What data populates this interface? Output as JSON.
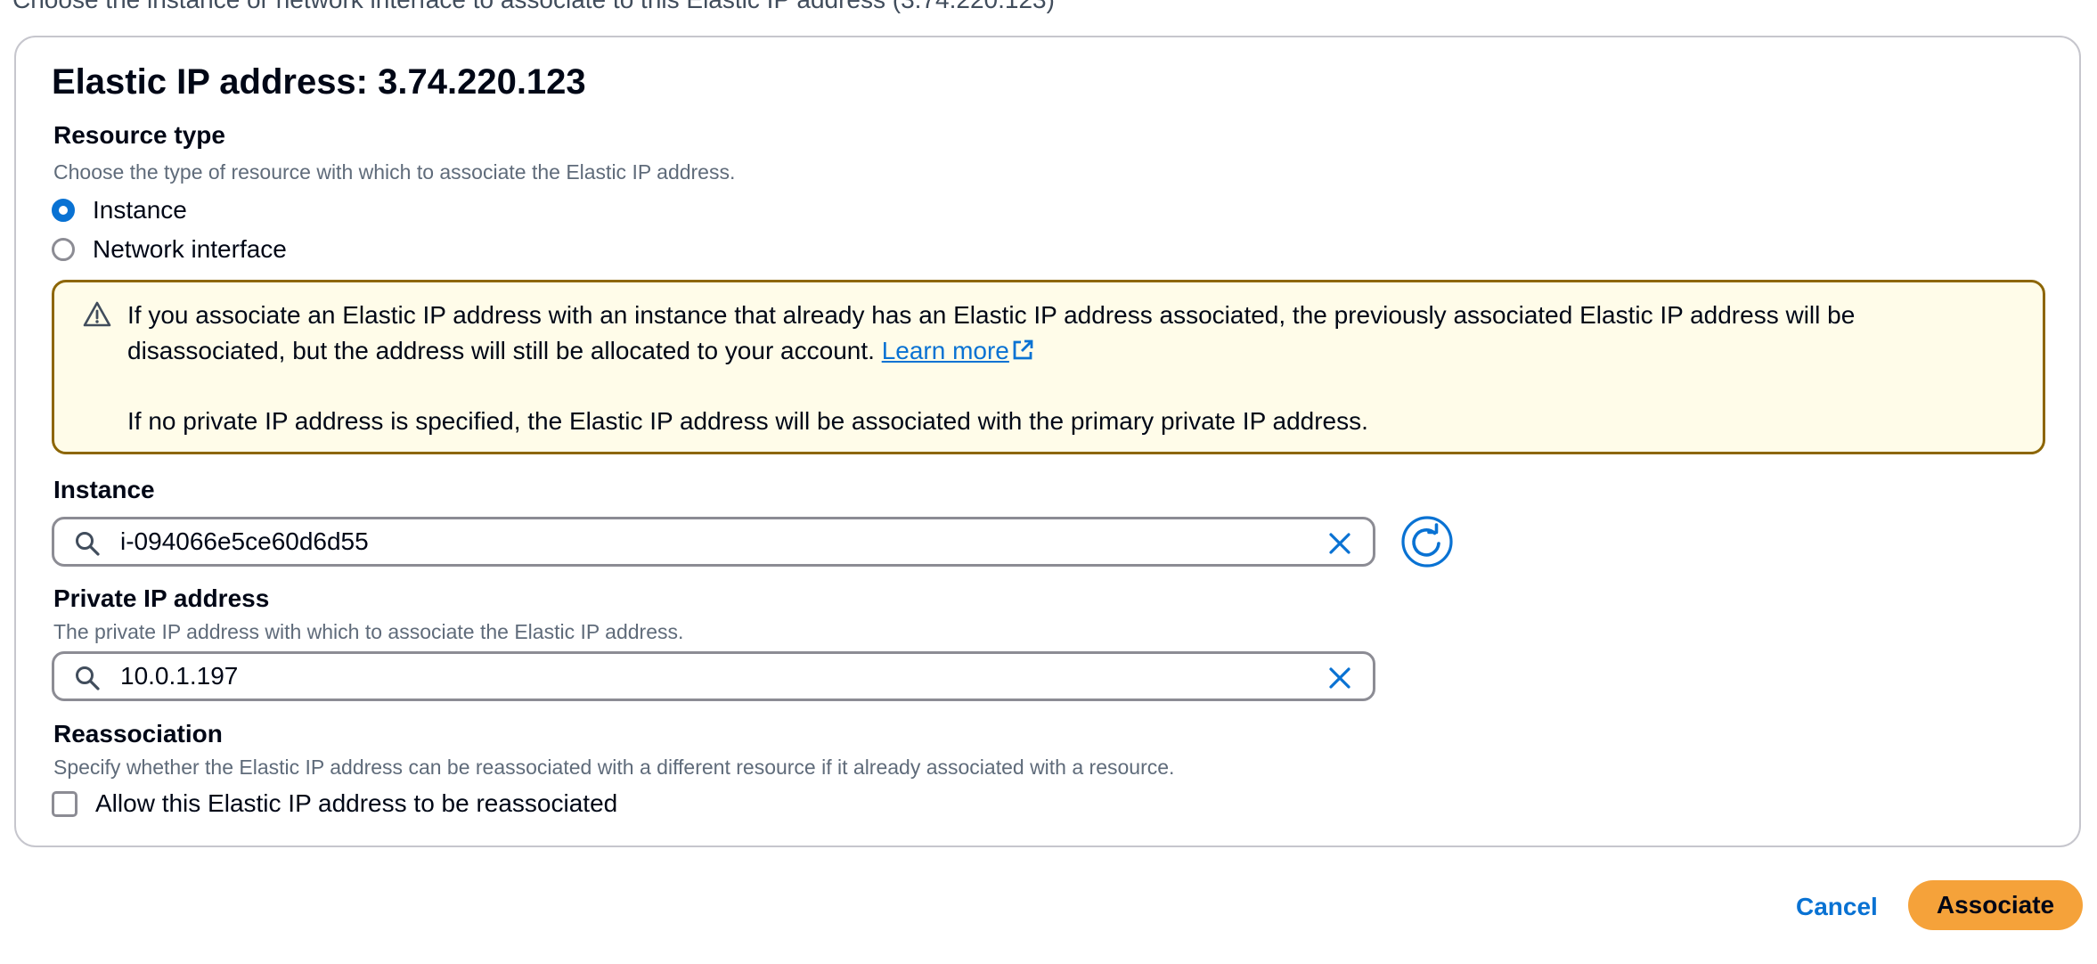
{
  "page": {
    "description": "Choose the instance or network interface to associate to this Elastic IP address (3.74.220.123)"
  },
  "container": {
    "title": "Elastic IP address: 3.74.220.123"
  },
  "resource_type": {
    "label": "Resource type",
    "description": "Choose the type of resource with which to associate the Elastic IP address.",
    "selected": "Instance",
    "options": [
      {
        "label": "Instance",
        "checked": true
      },
      {
        "label": "Network interface",
        "checked": false
      }
    ]
  },
  "alert": {
    "type": "warning",
    "line1": "If you associate an Elastic IP address with an instance that already has an Elastic IP address associated, the previously associated Elastic IP address will be disassociated, but the address will still be allocated to your account.",
    "link": "Learn more",
    "line2": "If no private IP address is specified, the Elastic IP address will be associated with the primary private IP address."
  },
  "instance": {
    "label": "Instance",
    "value": "i-094066e5ce60d6d55"
  },
  "private_ip": {
    "label": "Private IP address",
    "description": "The private IP address with which to associate the Elastic IP address.",
    "value": "10.0.1.197"
  },
  "reassociation": {
    "label": "Reassociation",
    "description": "Specify whether the Elastic IP address can be reassociated with a different resource if it already associated with a resource.",
    "checkbox_label": "Allow this Elastic IP address to be reassociated",
    "checked": false
  },
  "actions": {
    "cancel": "Cancel",
    "associate": "Associate"
  },
  "colors": {
    "accent": "#0972d3",
    "warning_border": "#8d6605",
    "warning_bg": "#fffce9",
    "primary_button": "#f5a23a"
  }
}
